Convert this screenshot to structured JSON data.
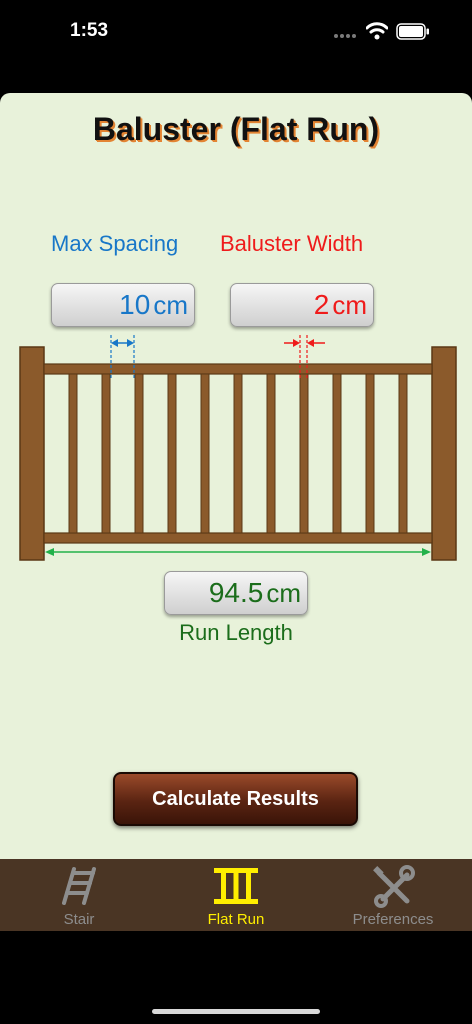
{
  "status": {
    "time": "1:53"
  },
  "page": {
    "title": "Baluster (Flat Run)"
  },
  "max_spacing": {
    "label": "Max Spacing",
    "value": "10",
    "unit": "cm"
  },
  "baluster_width": {
    "label": "Baluster Width",
    "value": "2",
    "unit": "cm"
  },
  "run_length": {
    "label": "Run Length",
    "value": "94.5",
    "unit": "cm"
  },
  "actions": {
    "calculate_label": "Calculate Results"
  },
  "tabs": [
    {
      "label": "Stair",
      "icon": "stair-icon",
      "selected": false
    },
    {
      "label": "Flat Run",
      "icon": "flat-run-icon",
      "selected": true
    },
    {
      "label": "Preferences",
      "icon": "tools-icon",
      "selected": false
    }
  ],
  "colors": {
    "background": "#e8f2da",
    "spacing_blue": "#1877c8",
    "width_red": "#ef1b1b",
    "run_green": "#1b6d1b",
    "wood": "#8b5a2b",
    "tab_bar": "#4a3524",
    "tab_selected": "#ffee00"
  }
}
